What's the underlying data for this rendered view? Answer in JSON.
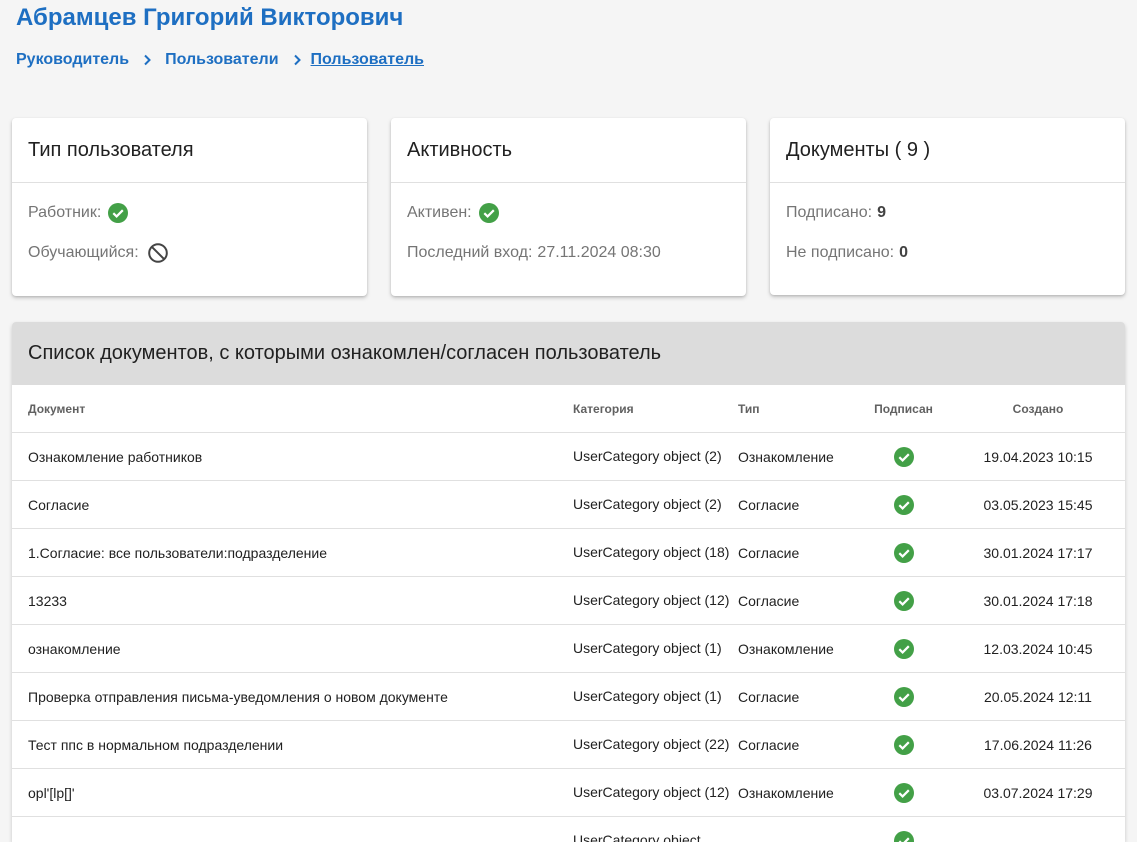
{
  "header": {
    "title": "Абрамцев Григорий Викторович",
    "breadcrumbs": [
      "Руководитель",
      "Пользователи",
      "Пользователь"
    ]
  },
  "cards": {
    "user_type": {
      "title": "Тип пользователя",
      "worker_label": "Работник:",
      "worker_icon": "check-circle-icon",
      "student_label": "Обучающийся:",
      "student_icon": "block-icon"
    },
    "activity": {
      "title": "Активность",
      "active_label": "Активен:",
      "active_icon": "check-circle-icon",
      "last_login_label": "Последний вход:",
      "last_login_value": "27.11.2024 08:30"
    },
    "documents": {
      "title": "Документы ( 9 )",
      "signed_label": "Подписано:",
      "signed_value": "9",
      "unsigned_label": "Не подписано:",
      "unsigned_value": "0"
    }
  },
  "doc_list": {
    "title": "Список документов, с которыми ознакомлен/согласен пользователь",
    "columns": {
      "document": "Документ",
      "category": "Категория",
      "type": "Тип",
      "signed": "Подписан",
      "created": "Создано"
    },
    "rows": [
      {
        "document": "Ознакомление работников",
        "category": "UserCategory object (2)",
        "type": "Ознакомление",
        "signed": true,
        "created": "19.04.2023 10:15"
      },
      {
        "document": "Согласие",
        "category": "UserCategory object (2)",
        "type": "Согласие",
        "signed": true,
        "created": "03.05.2023 15:45"
      },
      {
        "document": "1.Согласие: все пользователи:подразделение",
        "category": "UserCategory object (18)",
        "type": "Согласие",
        "signed": true,
        "created": "30.01.2024 17:17"
      },
      {
        "document": "13233",
        "category": "UserCategory object (12)",
        "type": "Согласие",
        "signed": true,
        "created": "30.01.2024 17:18"
      },
      {
        "document": "ознакомление",
        "category": "UserCategory object (1)",
        "type": "Ознакомление",
        "signed": true,
        "created": "12.03.2024 10:45"
      },
      {
        "document": "Проверка отправления письма-уведомления о новом документе",
        "category": "UserCategory object (1)",
        "type": "Согласие",
        "signed": true,
        "created": "20.05.2024 12:11"
      },
      {
        "document": "Тест ппс в нормальном подразделении",
        "category": "UserCategory object (22)",
        "type": "Согласие",
        "signed": true,
        "created": "17.06.2024 11:26"
      },
      {
        "document": "opl'[lp[]'",
        "category": "UserCategory object (12)",
        "type": "Ознакомление",
        "signed": true,
        "created": "03.07.2024 17:29"
      },
      {
        "document": "",
        "category": "UserCategory object",
        "type": "",
        "signed": true,
        "created": ""
      }
    ]
  },
  "colors": {
    "brand": "#1e6fc2",
    "success": "#43a047",
    "header_bg": "#dcdcdc"
  }
}
